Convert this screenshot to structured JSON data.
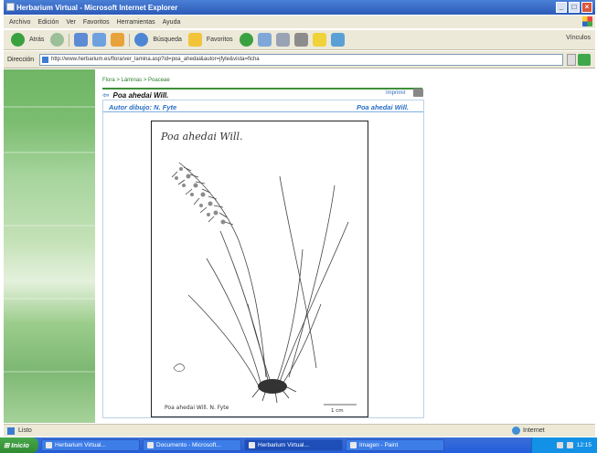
{
  "window": {
    "title": "Herbarium Virtual - Microsoft Internet Explorer",
    "buttons": [
      "_",
      "□",
      "×"
    ]
  },
  "menubar": {
    "items": [
      "Archivo",
      "Edición",
      "Ver",
      "Favoritos",
      "Herramientas",
      "Ayuda"
    ]
  },
  "toolbar": {
    "back_label": "Atrás",
    "search_label": "Búsqueda",
    "favorites_label": "Favoritos",
    "links_label": "Vínculos"
  },
  "address": {
    "label": "Dirección",
    "url": "http://www.herbarium.es/flora/ver_lamina.asp?id=poa_ahedai&autor=jfyte&vista=ficha"
  },
  "content": {
    "breadcrumb": "Flora > Láminas > Poaceae",
    "page_title": "Poa ahedai Will.",
    "small_link": "Imprimir",
    "author": "Autor dibujo: N. Fyte",
    "species_right": "Poa ahedai Will.",
    "plate": {
      "handwritten_title": "Poa ahedai Will.",
      "caption_bottom": "Poa ahedai Will. N. Fyte",
      "scale_note": "1 cm"
    }
  },
  "statusbar": {
    "left_text": "Listo",
    "zone_text": "Internet"
  },
  "taskbar": {
    "start_label": "Inicio",
    "tasks": [
      "Herbarium Virtual...",
      "Documento - Microsoft...",
      "Herbarium Virtual...",
      "Imagen - Paint"
    ],
    "clock": "12:15"
  }
}
